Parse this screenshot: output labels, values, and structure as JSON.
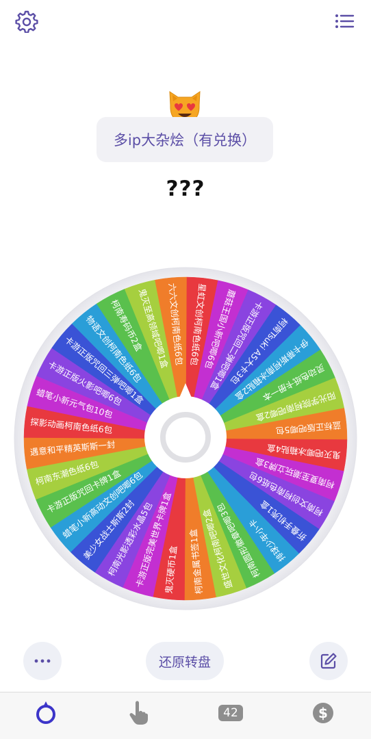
{
  "header": {
    "settings_icon": "gear-icon",
    "menu_icon": "list-icon"
  },
  "wheel_title": "多ip大杂烩（有兑换）",
  "result_text": "???",
  "accent_color": "#5b4ea6",
  "wheel": {
    "slices": [
      {
        "label": "星虹文创柯南色纸6包",
        "color": "#e8393f"
      },
      {
        "label": "蘑菇王国小新吧唧6包",
        "color": "#c32fd1"
      },
      {
        "label": "卡游正版咒回二弹吧唧1盒",
        "color": "#8a44e0"
      },
      {
        "label": "柯南Tsuki A5大卡3包",
        "color": "#3a53d6"
      },
      {
        "label": "伊卡蒂斯柯南冰箱贴2盒",
        "color": "#2a9ed8"
      },
      {
        "label": "灵动色纸卡册一本",
        "color": "#5ac04d"
      },
      {
        "label": "阳光学院柯南吧唧2盒",
        "color": "#a6cf3f"
      },
      {
        "label": "蓝标正版吧唧5包",
        "color": "#f07d2a"
      },
      {
        "label": "鬼灭吧唧冰箱贴4盒",
        "color": "#e8393f"
      },
      {
        "label": "柯南夏至潮玩立牌3盒",
        "color": "#c32fd1"
      },
      {
        "label": "柯南文创柯南色纸6包",
        "color": "#8a44e0"
      },
      {
        "label": "折叠手机壳1盒",
        "color": "#3a53d6"
      },
      {
        "label": "排球少年小卡",
        "color": "#2a9ed8"
      },
      {
        "label": "柯南圆形徽章吧唧3包",
        "color": "#5ac04d"
      },
      {
        "label": "盛世文化柯南吧唧2盒",
        "color": "#a6cf3f"
      },
      {
        "label": "柯南金属书签1盒",
        "color": "#f07d2a"
      },
      {
        "label": "鬼灭硬币1盒",
        "color": "#e8393f"
      },
      {
        "label": "卡游正版完美世界卡牌1盒",
        "color": "#c32fd1"
      },
      {
        "label": "柯南光影透彩水晶5包",
        "color": "#8a44e0"
      },
      {
        "label": "美少女战士斯斯2封",
        "color": "#3a53d6"
      },
      {
        "label": "蜡笔小新高动文创吧唧6包",
        "color": "#2a9ed8"
      },
      {
        "label": "卡游正版咒回卡牌1盒",
        "color": "#5ac04d"
      },
      {
        "label": "柯南东潮色纸6包",
        "color": "#a6cf3f"
      },
      {
        "label": "遇意和平精英斯斯一封",
        "color": "#f07d2a"
      },
      {
        "label": "探影动画柯南色纸6包",
        "color": "#e8393f"
      },
      {
        "label": "蜡笔小新元气包10包",
        "color": "#c32fd1"
      },
      {
        "label": "卡游正版火影吧唧6包",
        "color": "#8a44e0"
      },
      {
        "label": "卡游正版咒回三弹吧唧1盒",
        "color": "#3a53d6"
      },
      {
        "label": "物语文创柯南色纸6包",
        "color": "#2a9ed8"
      },
      {
        "label": "柯南寿码币2盒",
        "color": "#5ac04d"
      },
      {
        "label": "鬼灭至高领域吧唧1盒",
        "color": "#a6cf3f"
      },
      {
        "label": "六六文创柯南色纸6包",
        "color": "#f07d2a"
      }
    ]
  },
  "controls": {
    "more_icon": "more-dots-icon",
    "reset_label": "还原转盘",
    "edit_icon": "edit-icon"
  },
  "tabbar": {
    "tab_wheel_icon": "wheel-icon",
    "tab_hand_icon": "hand-pointer-icon",
    "count": "42",
    "tab_coin_icon": "dollar-coin-icon"
  }
}
